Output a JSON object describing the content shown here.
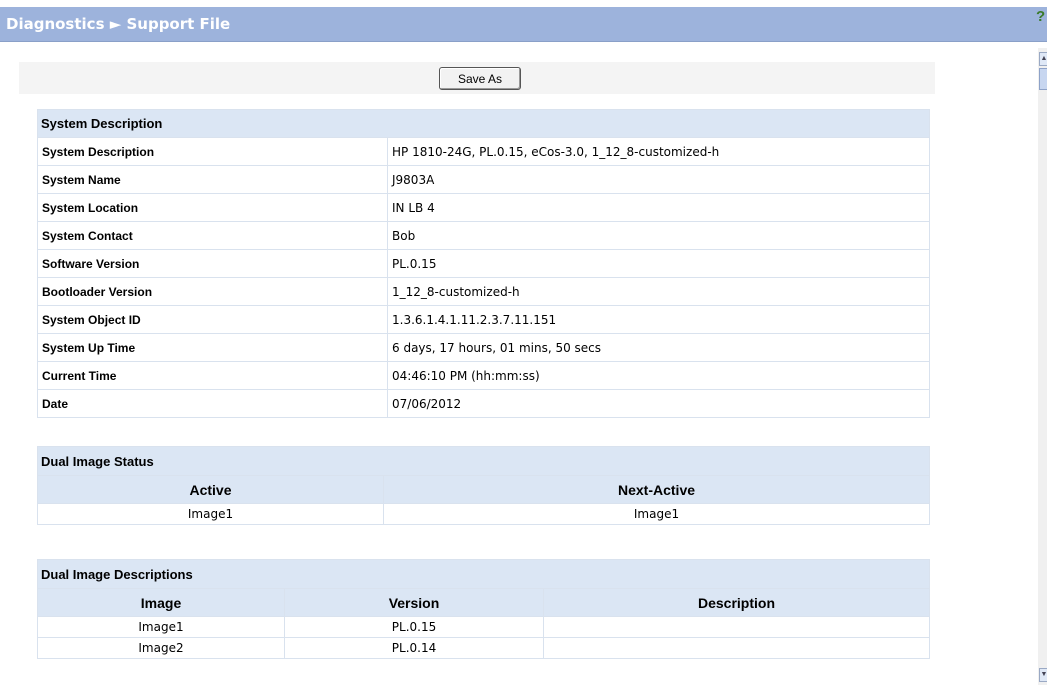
{
  "header": {
    "title": "Diagnostics ► Support File"
  },
  "toolbar": {
    "save_label": "Save As"
  },
  "system": {
    "title": "System Description",
    "rows": [
      {
        "label": "System Description",
        "value": "HP 1810-24G, PL.0.15, eCos-3.0, 1_12_8-customized-h"
      },
      {
        "label": "System Name",
        "value": "J9803A"
      },
      {
        "label": "System Location",
        "value": "IN LB 4"
      },
      {
        "label": "System Contact",
        "value": "Bob"
      },
      {
        "label": "Software Version",
        "value": "PL.0.15"
      },
      {
        "label": "Bootloader Version",
        "value": "1_12_8-customized-h"
      },
      {
        "label": "System Object ID",
        "value": "1.3.6.1.4.1.11.2.3.7.11.151"
      },
      {
        "label": "System Up Time",
        "value": "6 days, 17 hours, 01 mins, 50 secs"
      },
      {
        "label": "Current Time",
        "value": "04:46:10 PM (hh:mm:ss)"
      },
      {
        "label": "Date",
        "value": "07/06/2012"
      }
    ]
  },
  "dual_status": {
    "title": "Dual Image Status",
    "columns": [
      "Active",
      "Next-Active"
    ],
    "row": [
      "Image1",
      "Image1"
    ]
  },
  "dual_desc": {
    "title": "Dual Image Descriptions",
    "columns": [
      "Image",
      "Version",
      "Description"
    ],
    "rows": [
      [
        "Image1",
        "PL.0.15",
        ""
      ],
      [
        "Image2",
        "PL.0.14",
        ""
      ]
    ]
  },
  "colors": {
    "titlebar": "#9db3dc",
    "section_header": "#dbe6f4",
    "grid": "#d9e2ee"
  }
}
